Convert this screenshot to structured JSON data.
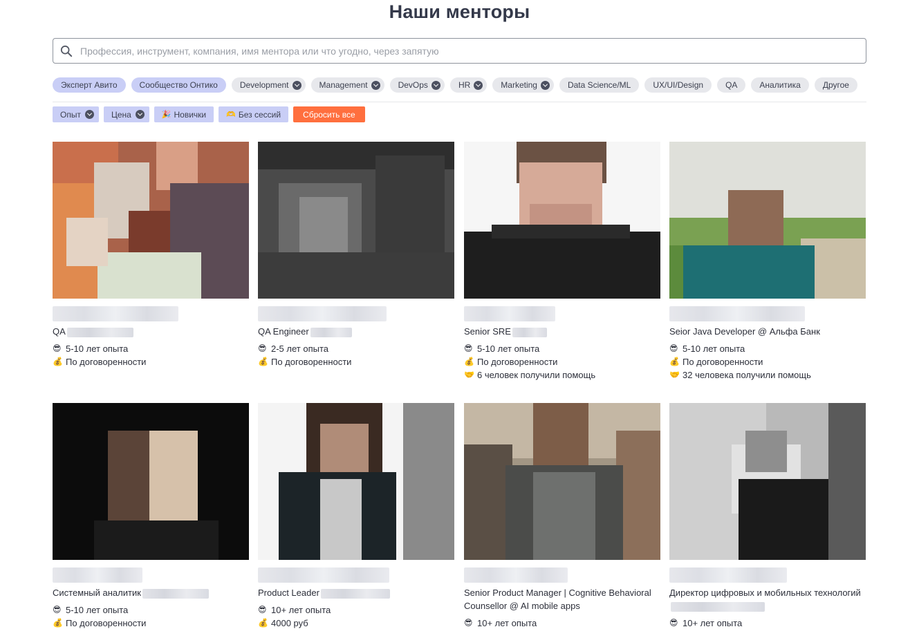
{
  "page": {
    "title": "Наши менторы"
  },
  "search": {
    "placeholder": "Профессия, инструмент, компания, имя ментора или что угодно, через запятую"
  },
  "chips": [
    {
      "label": "Эксперт Авито",
      "style": "blue",
      "caret": false
    },
    {
      "label": "Сообщество Онтико",
      "style": "blue",
      "caret": false
    },
    {
      "label": "Development",
      "style": "gray",
      "caret": true
    },
    {
      "label": "Management",
      "style": "gray",
      "caret": true
    },
    {
      "label": "DevOps",
      "style": "gray",
      "caret": true
    },
    {
      "label": "HR",
      "style": "gray",
      "caret": true
    },
    {
      "label": "Marketing",
      "style": "gray",
      "caret": true
    },
    {
      "label": "Data Science/ML",
      "style": "gray",
      "caret": false
    },
    {
      "label": "UX/UI/Design",
      "style": "gray",
      "caret": false
    },
    {
      "label": "QA",
      "style": "gray",
      "caret": false
    },
    {
      "label": "Аналитика",
      "style": "gray",
      "caret": false
    },
    {
      "label": "Другое",
      "style": "gray",
      "caret": false
    }
  ],
  "filters": {
    "experience": "Опыт",
    "price": "Цена",
    "newbies": "Новички",
    "no_sessions": "Без сессий",
    "reset": "Сбросить все"
  },
  "icons": {
    "experience": "😎",
    "price": "💰",
    "helped": "🤝",
    "newbies": "🎉",
    "no_sessions": "🫶"
  },
  "colors": {
    "accent": "#c9cef6",
    "reset": "#ff6f3e",
    "chip": "#e7e8ec"
  },
  "mentors": [
    {
      "role": "QA",
      "experience": "5-10 лет опыта",
      "price": "По договоренности",
      "helped": ""
    },
    {
      "role": "QA Engineer",
      "experience": "2-5 лет опыта",
      "price": "По договоренности",
      "helped": ""
    },
    {
      "role": "Senior SRE",
      "experience": "5-10 лет опыта",
      "price": "По договоренности",
      "helped": "6 человек получили помощь"
    },
    {
      "role": "Seior Java Developer @ Альфа Банк",
      "experience": "5-10 лет опыта",
      "price": "По договоренности",
      "helped": "32 человека получили помощь"
    },
    {
      "role": "Системный аналитик",
      "experience": "5-10 лет опыта",
      "price": "По договоренности",
      "helped": ""
    },
    {
      "role": "Product Leader",
      "experience": "10+ лет опыта",
      "price": "4000 руб",
      "helped": ""
    },
    {
      "role": "Senior Product Manager | Cognitive Behavioral Counsellor @ AI mobile apps",
      "experience": "10+ лет опыта",
      "price": "",
      "helped": ""
    },
    {
      "role": "Директор цифровых и мобильных технологий",
      "experience": "10+ лет опыта",
      "price": "",
      "helped": ""
    }
  ]
}
